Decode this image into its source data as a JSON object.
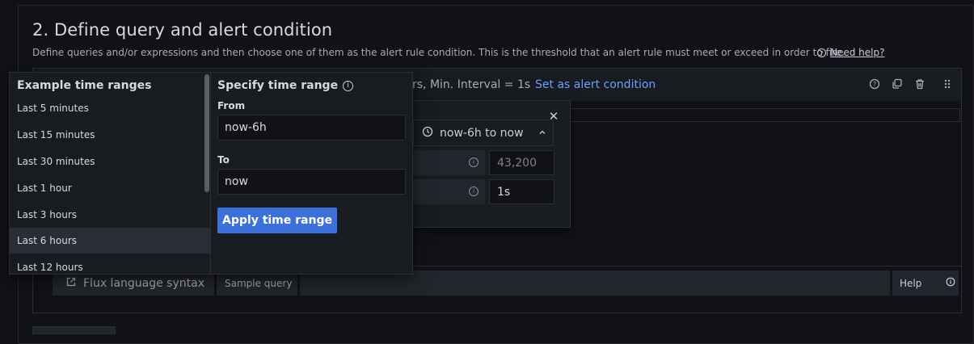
{
  "section": {
    "title": "2. Define query and alert condition",
    "description": "Define queries and/or expressions and then choose one of them as the alert rule condition. This is the threshold that an alert rule must meet or exceed in order to fire.",
    "help_link": "Need help?"
  },
  "query_header": {
    "summary_text": "rs, Min. Interval = 1s",
    "set_condition_link": "Set as alert condition"
  },
  "options_popover": {
    "time_range_button": "now-6h to now",
    "max_data_points_value": "43,200",
    "interval_value": "1s"
  },
  "time_picker": {
    "left_title": "Example time ranges",
    "ranges": [
      "Last 5 minutes",
      "Last 15 minutes",
      "Last 30 minutes",
      "Last 1 hour",
      "Last 3 hours",
      "Last 6 hours",
      "Last 12 hours"
    ],
    "selected_range": "Last 6 hours",
    "right_title": "Specify time range",
    "from_label": "From",
    "from_value": "now-6h",
    "to_label": "To",
    "to_value": "now",
    "apply_label": "Apply time range"
  },
  "editor_toolbar": {
    "flux_syntax": "Flux language syntax",
    "sample_query": "Sample query",
    "help": "Help"
  },
  "colors": {
    "background": "#111217",
    "panel": "#181b1f",
    "accent": "#3d71d9",
    "link": "#6e9fff"
  }
}
